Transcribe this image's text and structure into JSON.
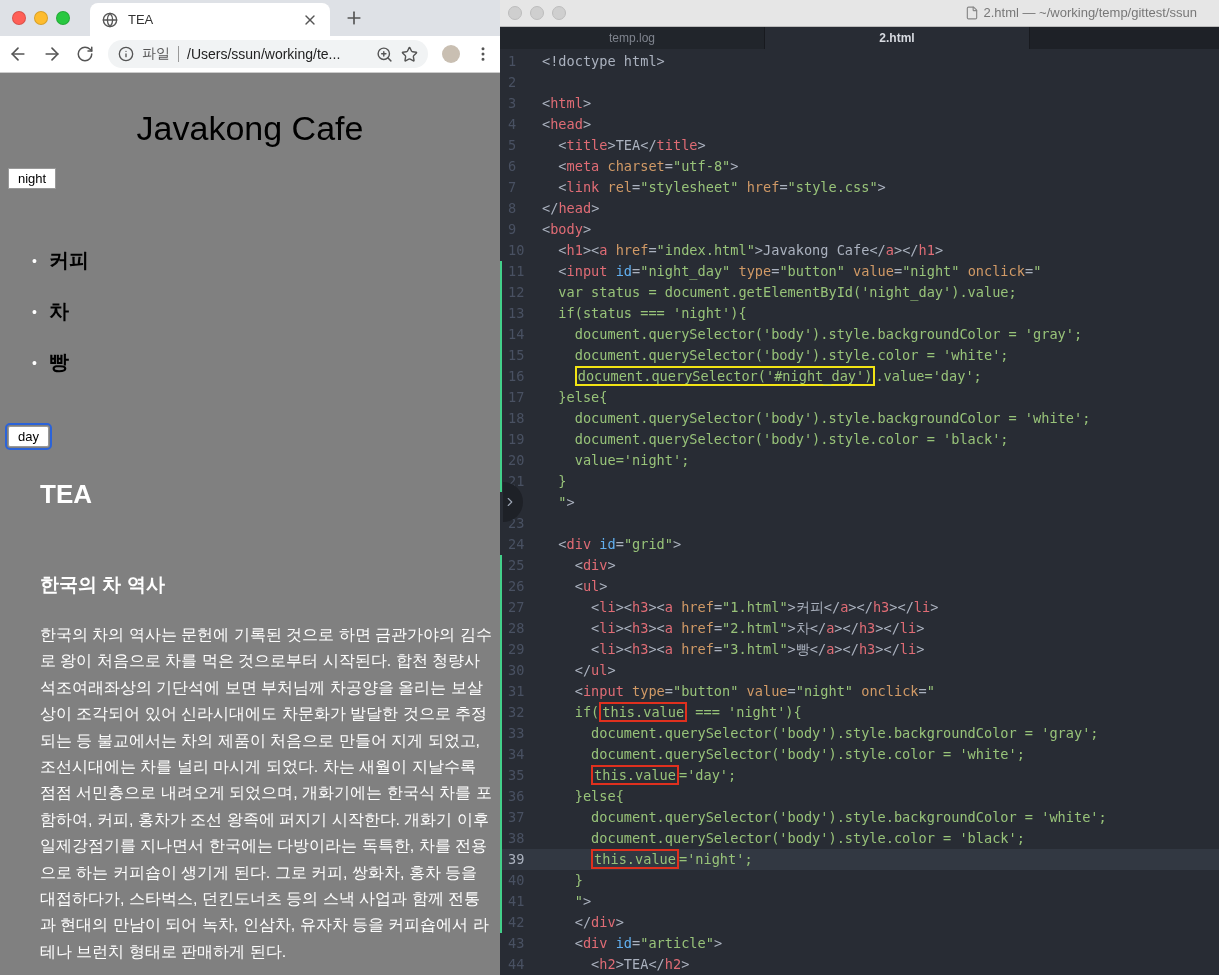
{
  "browser": {
    "tab": {
      "title": "TEA"
    },
    "address": {
      "scheme_label": "파일",
      "url": "/Users/ssun/working/te..."
    },
    "page": {
      "heading": "Javakong Cafe",
      "night_button": {
        "label": "night",
        "focused": false
      },
      "menu": [
        {
          "bullet": "•",
          "label": "커피"
        },
        {
          "bullet": "•",
          "label": "차"
        },
        {
          "bullet": "•",
          "label": "빵"
        }
      ],
      "day_button": {
        "label": "day",
        "focused": true
      },
      "article": {
        "title": "TEA",
        "subtitle": "한국의 차 역사",
        "paragraph": "한국의 차의 역사는 문헌에 기록된 것으로 하면 금관가야의 김수로 왕이 처음으로 차를 먹은 것으로부터 시작된다. 합천 청량사 석조여래좌상의 기단석에 보면 부처님께 차공양을 올리는 보살상이 조각되어 있어 신라시대에도 차문화가 발달한 것으로 추정되는 등 불교에서는 차의 제품이 처음으로 만들어 지게 되었고, 조선시대에는 차를 널리 마시게 되었다. 차는 새월이 지날수록 점점 서민층으로 내려오게 되었으며, 개화기에는 한국식 차를 포함하여, 커피, 홍차가 조선 왕족에 퍼지기 시작한다. 개화기 이후 일제강점기를 지나면서 한국에는 다방이라는 독특한, 차를 전용으로 하는 커피숍이 생기게 된다. 그로 커피, 쌍화차, 홍차 등을 대접하다가, 스타벅스, 던킨도너츠 등의 스낵 사업과 함께 전통과 현대의 만남이 되어 녹차, 인삼차, 유자차 등을 커피숍에서 라테나 브런치 형태로 판매하게 된다."
      }
    }
  },
  "editor": {
    "window": {
      "title": "2.html — ~/working/temp/gittest/ssun"
    },
    "tabs": [
      {
        "label": "temp.log",
        "selected": false
      },
      {
        "label": "2.html",
        "selected": true
      }
    ],
    "lines": [
      {
        "n": "1",
        "changed": false,
        "current": false,
        "tokens": [
          {
            "kind": "p",
            "text": "<!doctype html>"
          }
        ]
      },
      {
        "n": "2",
        "changed": false,
        "current": false
      },
      {
        "n": "3",
        "changed": false,
        "current": false,
        "tokens": [
          {
            "kind": "p",
            "text": "<"
          },
          {
            "kind": "t",
            "text": "html"
          },
          {
            "kind": "p",
            "text": ">"
          }
        ]
      },
      {
        "n": "4",
        "changed": false,
        "current": false,
        "tokens": [
          {
            "kind": "p",
            "text": "<"
          },
          {
            "kind": "t",
            "text": "head"
          },
          {
            "kind": "p",
            "text": ">"
          }
        ]
      },
      {
        "n": "5",
        "changed": false,
        "current": false,
        "tokens": [
          {
            "kind": "p",
            "text": "  <"
          },
          {
            "kind": "t",
            "text": "title"
          },
          {
            "kind": "p",
            "text": ">TEA</"
          },
          {
            "kind": "t",
            "text": "title"
          },
          {
            "kind": "p",
            "text": ">"
          }
        ]
      },
      {
        "n": "6",
        "changed": false,
        "current": false,
        "tokens": [
          {
            "kind": "p",
            "text": "  <"
          },
          {
            "kind": "t",
            "text": "meta"
          },
          {
            "kind": "a",
            "text": " charset"
          },
          {
            "kind": "p",
            "text": "="
          },
          {
            "kind": "s",
            "text": "\"utf-8\""
          },
          {
            "kind": "p",
            "text": ">"
          }
        ]
      },
      {
        "n": "7",
        "changed": false,
        "current": false,
        "tokens": [
          {
            "kind": "p",
            "text": "  <"
          },
          {
            "kind": "t",
            "text": "link"
          },
          {
            "kind": "a",
            "text": " rel"
          },
          {
            "kind": "p",
            "text": "="
          },
          {
            "kind": "s",
            "text": "\"stylesheet\""
          },
          {
            "kind": "a",
            "text": " href"
          },
          {
            "kind": "p",
            "text": "="
          },
          {
            "kind": "s",
            "text": "\"style.css\""
          },
          {
            "kind": "p",
            "text": ">"
          }
        ]
      },
      {
        "n": "8",
        "changed": false,
        "current": false,
        "tokens": [
          {
            "kind": "p",
            "text": "</"
          },
          {
            "kind": "t",
            "text": "head"
          },
          {
            "kind": "p",
            "text": ">"
          }
        ]
      },
      {
        "n": "9",
        "changed": false,
        "current": false,
        "tokens": [
          {
            "kind": "p",
            "text": "<"
          },
          {
            "kind": "t",
            "text": "body"
          },
          {
            "kind": "p",
            "text": ">"
          }
        ]
      },
      {
        "n": "10",
        "changed": false,
        "current": false,
        "tokens": [
          {
            "kind": "p",
            "text": "  <"
          },
          {
            "kind": "t",
            "text": "h1"
          },
          {
            "kind": "p",
            "text": "><"
          },
          {
            "kind": "t",
            "text": "a"
          },
          {
            "kind": "a",
            "text": " href"
          },
          {
            "kind": "p",
            "text": "="
          },
          {
            "kind": "s",
            "text": "\"index.html\""
          },
          {
            "kind": "p",
            "text": ">Javakong Cafe</"
          },
          {
            "kind": "t",
            "text": "a"
          },
          {
            "kind": "p",
            "text": "></"
          },
          {
            "kind": "t",
            "text": "h1"
          },
          {
            "kind": "p",
            "text": ">"
          }
        ]
      },
      {
        "n": "11",
        "changed": true,
        "current": false,
        "tokens": [
          {
            "kind": "p",
            "text": "  <"
          },
          {
            "kind": "t",
            "text": "input"
          },
          {
            "kind": "i",
            "text": " id"
          },
          {
            "kind": "p",
            "text": "="
          },
          {
            "kind": "s",
            "text": "\"night_day\""
          },
          {
            "kind": "a",
            "text": " type"
          },
          {
            "kind": "p",
            "text": "="
          },
          {
            "kind": "s",
            "text": "\"button\""
          },
          {
            "kind": "a",
            "text": " value"
          },
          {
            "kind": "p",
            "text": "="
          },
          {
            "kind": "s",
            "text": "\"night\""
          },
          {
            "kind": "a",
            "text": " onclick"
          },
          {
            "kind": "p",
            "text": "="
          },
          {
            "kind": "s",
            "text": "\""
          }
        ]
      },
      {
        "n": "12",
        "changed": true,
        "current": false,
        "tokens": [
          {
            "kind": "s",
            "text": "  var status = document.getElementById('night_day').value;"
          }
        ]
      },
      {
        "n": "13",
        "changed": true,
        "current": false,
        "tokens": [
          {
            "kind": "s",
            "text": "  if(status === 'night'){"
          }
        ]
      },
      {
        "n": "14",
        "changed": true,
        "current": false,
        "tokens": [
          {
            "kind": "s",
            "text": "    document.querySelector('body').style.backgroundColor = 'gray';"
          }
        ]
      },
      {
        "n": "15",
        "changed": true,
        "current": false,
        "tokens": [
          {
            "kind": "s",
            "text": "    document.querySelector('body').style.color = 'white';"
          }
        ]
      },
      {
        "n": "16",
        "changed": true,
        "current": false,
        "tokens": [
          {
            "kind": "s",
            "text": "    document.querySelector('#night_day')",
            "color": "#f2e414"
          },
          {
            "kind": "s",
            "text": ".value='day';"
          }
        ]
      },
      {
        "n": "17",
        "changed": true,
        "current": false,
        "tokens": [
          {
            "kind": "s",
            "text": "  }else{"
          }
        ]
      },
      {
        "n": "18",
        "changed": true,
        "current": false,
        "tokens": [
          {
            "kind": "s",
            "text": "    document.querySelector('body').style.backgroundColor = 'white';"
          }
        ]
      },
      {
        "n": "19",
        "changed": true,
        "current": false,
        "tokens": [
          {
            "kind": "s",
            "text": "    document.querySelector('body').style.color = 'black';"
          }
        ]
      },
      {
        "n": "20",
        "changed": true,
        "current": false,
        "tokens": [
          {
            "kind": "s",
            "text": "    value='night';"
          }
        ]
      },
      {
        "n": "21",
        "changed": true,
        "current": false,
        "tokens": [
          {
            "kind": "s",
            "text": "  }"
          }
        ]
      },
      {
        "changed": false,
        "current": false,
        "tokens": [
          {
            "kind": "s",
            "text": "  \""
          },
          {
            "kind": "p",
            "text": ">"
          }
        ]
      },
      {
        "n": "23",
        "changed": false,
        "current": false
      },
      {
        "n": "24",
        "changed": false,
        "current": false,
        "tokens": [
          {
            "kind": "p",
            "text": "  <"
          },
          {
            "kind": "t",
            "text": "div"
          },
          {
            "kind": "i",
            "text": " id"
          },
          {
            "kind": "p",
            "text": "="
          },
          {
            "kind": "s",
            "text": "\"grid\""
          },
          {
            "kind": "p",
            "text": ">"
          }
        ]
      },
      {
        "n": "25",
        "changed": true,
        "current": false,
        "tokens": [
          {
            "kind": "p",
            "text": "    <"
          },
          {
            "kind": "t",
            "text": "div"
          },
          {
            "kind": "p",
            "text": ">"
          }
        ]
      },
      {
        "n": "26",
        "changed": true,
        "current": false,
        "tokens": [
          {
            "kind": "p",
            "text": "    <"
          },
          {
            "kind": "t",
            "text": "ul"
          },
          {
            "kind": "p",
            "text": ">"
          }
        ]
      },
      {
        "n": "27",
        "changed": true,
        "current": false,
        "tokens": [
          {
            "kind": "p",
            "text": "      <"
          },
          {
            "kind": "t",
            "text": "li"
          },
          {
            "kind": "p",
            "text": "><"
          },
          {
            "kind": "t",
            "text": "h3"
          },
          {
            "kind": "p",
            "text": "><"
          },
          {
            "kind": "t",
            "text": "a"
          },
          {
            "kind": "a",
            "text": " href"
          },
          {
            "kind": "p",
            "text": "="
          },
          {
            "kind": "s",
            "text": "\"1.html\""
          },
          {
            "kind": "p",
            "text": ">커피</"
          },
          {
            "kind": "t",
            "text": "a"
          },
          {
            "kind": "p",
            "text": "></"
          },
          {
            "kind": "t",
            "text": "h3"
          },
          {
            "kind": "p",
            "text": "></"
          },
          {
            "kind": "t",
            "text": "li"
          },
          {
            "kind": "p",
            "text": ">"
          }
        ]
      },
      {
        "n": "28",
        "changed": true,
        "current": false,
        "tokens": [
          {
            "kind": "p",
            "text": "      <"
          },
          {
            "kind": "t",
            "text": "li"
          },
          {
            "kind": "p",
            "text": "><"
          },
          {
            "kind": "t",
            "text": "h3"
          },
          {
            "kind": "p",
            "text": "><"
          },
          {
            "kind": "t",
            "text": "a"
          },
          {
            "kind": "a",
            "text": " href"
          },
          {
            "kind": "p",
            "text": "="
          },
          {
            "kind": "s",
            "text": "\"2.html\""
          },
          {
            "kind": "p",
            "text": ">차</"
          },
          {
            "kind": "t",
            "text": "a"
          },
          {
            "kind": "p",
            "text": "></"
          },
          {
            "kind": "t",
            "text": "h3"
          },
          {
            "kind": "p",
            "text": "></"
          },
          {
            "kind": "t",
            "text": "li"
          },
          {
            "kind": "p",
            "text": ">"
          }
        ]
      },
      {
        "n": "29",
        "changed": true,
        "current": false,
        "tokens": [
          {
            "kind": "p",
            "text": "      <"
          },
          {
            "kind": "t",
            "text": "li"
          },
          {
            "kind": "p",
            "text": "><"
          },
          {
            "kind": "t",
            "text": "h3"
          },
          {
            "kind": "p",
            "text": "><"
          },
          {
            "kind": "t",
            "text": "a"
          },
          {
            "kind": "a",
            "text": " href"
          },
          {
            "kind": "p",
            "text": "="
          },
          {
            "kind": "s",
            "text": "\"3.html\""
          },
          {
            "kind": "p",
            "text": ">빵</"
          },
          {
            "kind": "t",
            "text": "a"
          },
          {
            "kind": "p",
            "text": "></"
          },
          {
            "kind": "t",
            "text": "h3"
          },
          {
            "kind": "p",
            "text": "></"
          },
          {
            "kind": "t",
            "text": "li"
          },
          {
            "kind": "p",
            "text": ">"
          }
        ]
      },
      {
        "n": "30",
        "changed": true,
        "current": false,
        "tokens": [
          {
            "kind": "p",
            "text": "    </"
          },
          {
            "kind": "t",
            "text": "ul"
          },
          {
            "kind": "p",
            "text": ">"
          }
        ]
      },
      {
        "n": "31",
        "changed": true,
        "current": false,
        "tokens": [
          {
            "kind": "p",
            "text": "    <"
          },
          {
            "kind": "t",
            "text": "input"
          },
          {
            "kind": "a",
            "text": " type"
          },
          {
            "kind": "p",
            "text": "="
          },
          {
            "kind": "s",
            "text": "\"button\""
          },
          {
            "kind": "a",
            "text": " value"
          },
          {
            "kind": "p",
            "text": "="
          },
          {
            "kind": "s",
            "text": "\"night\""
          },
          {
            "kind": "a",
            "text": " onclick"
          },
          {
            "kind": "p",
            "text": "="
          },
          {
            "kind": "s",
            "text": "\""
          }
        ]
      },
      {
        "n": "32",
        "changed": true,
        "current": false,
        "tokens": [
          {
            "kind": "s",
            "text": "    if("
          },
          {
            "kind": "s",
            "text": "this.value",
            "color": "#e0301e"
          },
          {
            "kind": "s",
            "text": " === 'night'){"
          }
        ]
      },
      {
        "n": "33",
        "changed": true,
        "current": false,
        "tokens": [
          {
            "kind": "s",
            "text": "      document.querySelector('body').style.backgroundColor = 'gray';"
          }
        ]
      },
      {
        "n": "34",
        "changed": true,
        "current": false,
        "tokens": [
          {
            "kind": "s",
            "text": "      document.querySelector('body').style.color = 'white';"
          }
        ]
      },
      {
        "n": "35",
        "changed": true,
        "current": false,
        "tokens": [
          {
            "kind": "s",
            "text": "      this.value",
            "color": "#e0301e"
          },
          {
            "kind": "s",
            "text": "='day';"
          }
        ]
      },
      {
        "n": "36",
        "changed": true,
        "current": false,
        "tokens": [
          {
            "kind": "s",
            "text": "    }else{"
          }
        ]
      },
      {
        "n": "37",
        "changed": true,
        "current": false,
        "tokens": [
          {
            "kind": "s",
            "text": "      document.querySelector('body').style.backgroundColor = 'white';"
          }
        ]
      },
      {
        "n": "38",
        "changed": true,
        "current": false,
        "tokens": [
          {
            "kind": "s",
            "text": "      document.querySelector('body').style.color = 'black';"
          }
        ]
      },
      {
        "n": "39",
        "changed": true,
        "current": true,
        "tokens": [
          {
            "kind": "s",
            "text": "      this.value",
            "color": "#e0301e"
          },
          {
            "kind": "s",
            "text": "='night';"
          }
        ]
      },
      {
        "n": "40",
        "changed": true,
        "current": false,
        "tokens": [
          {
            "kind": "s",
            "text": "    }"
          }
        ]
      },
      {
        "n": "41",
        "changed": true,
        "current": false,
        "tokens": [
          {
            "kind": "s",
            "text": "    \""
          },
          {
            "kind": "p",
            "text": ">"
          }
        ]
      },
      {
        "n": "42",
        "changed": true,
        "current": false,
        "tokens": [
          {
            "kind": "p",
            "text": "    </"
          },
          {
            "kind": "t",
            "text": "div"
          },
          {
            "kind": "p",
            "text": ">"
          }
        ]
      },
      {
        "n": "43",
        "changed": false,
        "current": false,
        "tokens": [
          {
            "kind": "p",
            "text": "    <"
          },
          {
            "kind": "t",
            "text": "div"
          },
          {
            "kind": "i",
            "text": " id"
          },
          {
            "kind": "p",
            "text": "="
          },
          {
            "kind": "s",
            "text": "\"article\""
          },
          {
            "kind": "p",
            "text": ">"
          }
        ]
      },
      {
        "n": "44",
        "changed": false,
        "current": false,
        "tokens": [
          {
            "kind": "p",
            "text": "      <"
          },
          {
            "kind": "t",
            "text": "h2"
          },
          {
            "kind": "p",
            "text": ">TEA</"
          },
          {
            "kind": "t",
            "text": "h2"
          },
          {
            "kind": "p",
            "text": ">"
          }
        ]
      }
    ]
  }
}
